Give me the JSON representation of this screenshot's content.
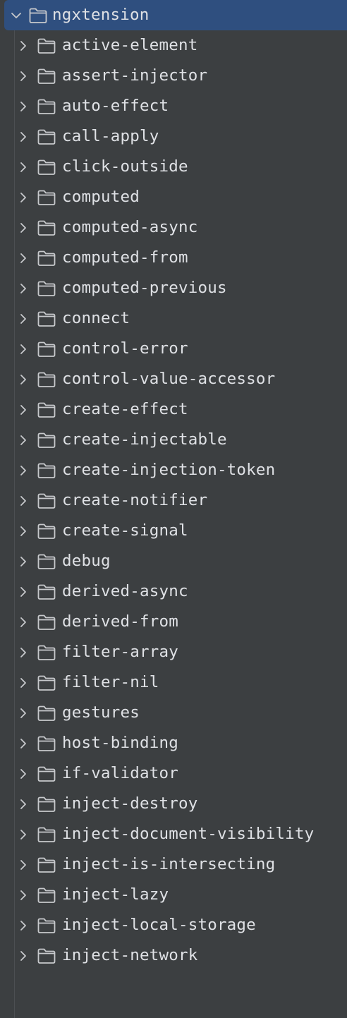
{
  "tree": {
    "root": {
      "label": "ngxtension",
      "expanded": true,
      "icon": "folder-icon",
      "chevron": "chevron-down-icon"
    },
    "children": [
      {
        "label": "active-element"
      },
      {
        "label": "assert-injector"
      },
      {
        "label": "auto-effect"
      },
      {
        "label": "call-apply"
      },
      {
        "label": "click-outside"
      },
      {
        "label": "computed"
      },
      {
        "label": "computed-async"
      },
      {
        "label": "computed-from"
      },
      {
        "label": "computed-previous"
      },
      {
        "label": "connect"
      },
      {
        "label": "control-error"
      },
      {
        "label": "control-value-accessor"
      },
      {
        "label": "create-effect"
      },
      {
        "label": "create-injectable"
      },
      {
        "label": "create-injection-token"
      },
      {
        "label": "create-notifier"
      },
      {
        "label": "create-signal"
      },
      {
        "label": "debug"
      },
      {
        "label": "derived-async"
      },
      {
        "label": "derived-from"
      },
      {
        "label": "filter-array"
      },
      {
        "label": "filter-nil"
      },
      {
        "label": "gestures"
      },
      {
        "label": "host-binding"
      },
      {
        "label": "if-validator"
      },
      {
        "label": "inject-destroy"
      },
      {
        "label": "inject-document-visibility"
      },
      {
        "label": "inject-is-intersecting"
      },
      {
        "label": "inject-lazy"
      },
      {
        "label": "inject-local-storage"
      },
      {
        "label": "inject-network"
      }
    ]
  },
  "colors": {
    "background": "#3c3f41",
    "selection": "#2f4f7f",
    "text": "#dfe1e5",
    "icon": "#c7c9cc"
  }
}
